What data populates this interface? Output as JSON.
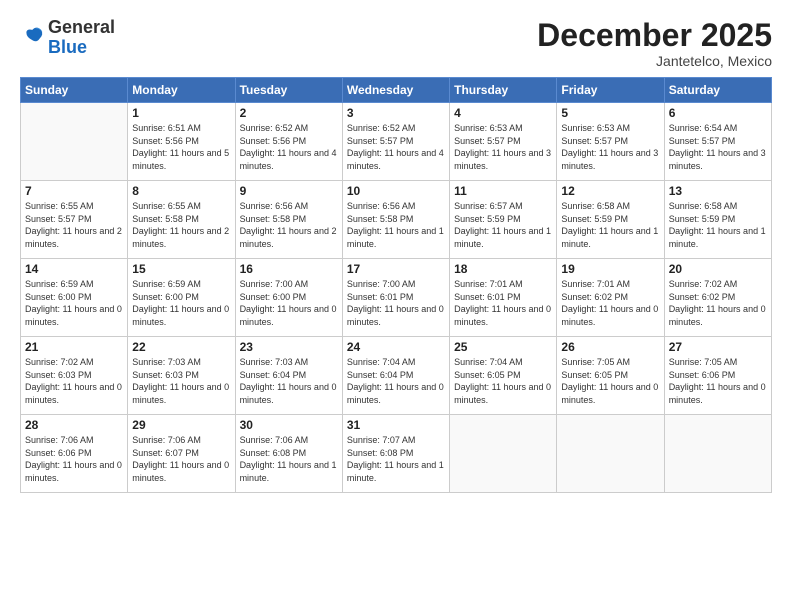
{
  "logo": {
    "general": "General",
    "blue": "Blue"
  },
  "title": "December 2025",
  "subtitle": "Jantetelco, Mexico",
  "days_header": [
    "Sunday",
    "Monday",
    "Tuesday",
    "Wednesday",
    "Thursday",
    "Friday",
    "Saturday"
  ],
  "weeks": [
    [
      {
        "day": "",
        "sunrise": "",
        "sunset": "",
        "daylight": ""
      },
      {
        "day": "1",
        "sunrise": "Sunrise: 6:51 AM",
        "sunset": "Sunset: 5:56 PM",
        "daylight": "Daylight: 11 hours and 5 minutes."
      },
      {
        "day": "2",
        "sunrise": "Sunrise: 6:52 AM",
        "sunset": "Sunset: 5:56 PM",
        "daylight": "Daylight: 11 hours and 4 minutes."
      },
      {
        "day": "3",
        "sunrise": "Sunrise: 6:52 AM",
        "sunset": "Sunset: 5:57 PM",
        "daylight": "Daylight: 11 hours and 4 minutes."
      },
      {
        "day": "4",
        "sunrise": "Sunrise: 6:53 AM",
        "sunset": "Sunset: 5:57 PM",
        "daylight": "Daylight: 11 hours and 3 minutes."
      },
      {
        "day": "5",
        "sunrise": "Sunrise: 6:53 AM",
        "sunset": "Sunset: 5:57 PM",
        "daylight": "Daylight: 11 hours and 3 minutes."
      },
      {
        "day": "6",
        "sunrise": "Sunrise: 6:54 AM",
        "sunset": "Sunset: 5:57 PM",
        "daylight": "Daylight: 11 hours and 3 minutes."
      }
    ],
    [
      {
        "day": "7",
        "sunrise": "Sunrise: 6:55 AM",
        "sunset": "Sunset: 5:57 PM",
        "daylight": "Daylight: 11 hours and 2 minutes."
      },
      {
        "day": "8",
        "sunrise": "Sunrise: 6:55 AM",
        "sunset": "Sunset: 5:58 PM",
        "daylight": "Daylight: 11 hours and 2 minutes."
      },
      {
        "day": "9",
        "sunrise": "Sunrise: 6:56 AM",
        "sunset": "Sunset: 5:58 PM",
        "daylight": "Daylight: 11 hours and 2 minutes."
      },
      {
        "day": "10",
        "sunrise": "Sunrise: 6:56 AM",
        "sunset": "Sunset: 5:58 PM",
        "daylight": "Daylight: 11 hours and 1 minute."
      },
      {
        "day": "11",
        "sunrise": "Sunrise: 6:57 AM",
        "sunset": "Sunset: 5:59 PM",
        "daylight": "Daylight: 11 hours and 1 minute."
      },
      {
        "day": "12",
        "sunrise": "Sunrise: 6:58 AM",
        "sunset": "Sunset: 5:59 PM",
        "daylight": "Daylight: 11 hours and 1 minute."
      },
      {
        "day": "13",
        "sunrise": "Sunrise: 6:58 AM",
        "sunset": "Sunset: 5:59 PM",
        "daylight": "Daylight: 11 hours and 1 minute."
      }
    ],
    [
      {
        "day": "14",
        "sunrise": "Sunrise: 6:59 AM",
        "sunset": "Sunset: 6:00 PM",
        "daylight": "Daylight: 11 hours and 0 minutes."
      },
      {
        "day": "15",
        "sunrise": "Sunrise: 6:59 AM",
        "sunset": "Sunset: 6:00 PM",
        "daylight": "Daylight: 11 hours and 0 minutes."
      },
      {
        "day": "16",
        "sunrise": "Sunrise: 7:00 AM",
        "sunset": "Sunset: 6:00 PM",
        "daylight": "Daylight: 11 hours and 0 minutes."
      },
      {
        "day": "17",
        "sunrise": "Sunrise: 7:00 AM",
        "sunset": "Sunset: 6:01 PM",
        "daylight": "Daylight: 11 hours and 0 minutes."
      },
      {
        "day": "18",
        "sunrise": "Sunrise: 7:01 AM",
        "sunset": "Sunset: 6:01 PM",
        "daylight": "Daylight: 11 hours and 0 minutes."
      },
      {
        "day": "19",
        "sunrise": "Sunrise: 7:01 AM",
        "sunset": "Sunset: 6:02 PM",
        "daylight": "Daylight: 11 hours and 0 minutes."
      },
      {
        "day": "20",
        "sunrise": "Sunrise: 7:02 AM",
        "sunset": "Sunset: 6:02 PM",
        "daylight": "Daylight: 11 hours and 0 minutes."
      }
    ],
    [
      {
        "day": "21",
        "sunrise": "Sunrise: 7:02 AM",
        "sunset": "Sunset: 6:03 PM",
        "daylight": "Daylight: 11 hours and 0 minutes."
      },
      {
        "day": "22",
        "sunrise": "Sunrise: 7:03 AM",
        "sunset": "Sunset: 6:03 PM",
        "daylight": "Daylight: 11 hours and 0 minutes."
      },
      {
        "day": "23",
        "sunrise": "Sunrise: 7:03 AM",
        "sunset": "Sunset: 6:04 PM",
        "daylight": "Daylight: 11 hours and 0 minutes."
      },
      {
        "day": "24",
        "sunrise": "Sunrise: 7:04 AM",
        "sunset": "Sunset: 6:04 PM",
        "daylight": "Daylight: 11 hours and 0 minutes."
      },
      {
        "day": "25",
        "sunrise": "Sunrise: 7:04 AM",
        "sunset": "Sunset: 6:05 PM",
        "daylight": "Daylight: 11 hours and 0 minutes."
      },
      {
        "day": "26",
        "sunrise": "Sunrise: 7:05 AM",
        "sunset": "Sunset: 6:05 PM",
        "daylight": "Daylight: 11 hours and 0 minutes."
      },
      {
        "day": "27",
        "sunrise": "Sunrise: 7:05 AM",
        "sunset": "Sunset: 6:06 PM",
        "daylight": "Daylight: 11 hours and 0 minutes."
      }
    ],
    [
      {
        "day": "28",
        "sunrise": "Sunrise: 7:06 AM",
        "sunset": "Sunset: 6:06 PM",
        "daylight": "Daylight: 11 hours and 0 minutes."
      },
      {
        "day": "29",
        "sunrise": "Sunrise: 7:06 AM",
        "sunset": "Sunset: 6:07 PM",
        "daylight": "Daylight: 11 hours and 0 minutes."
      },
      {
        "day": "30",
        "sunrise": "Sunrise: 7:06 AM",
        "sunset": "Sunset: 6:08 PM",
        "daylight": "Daylight: 11 hours and 1 minute."
      },
      {
        "day": "31",
        "sunrise": "Sunrise: 7:07 AM",
        "sunset": "Sunset: 6:08 PM",
        "daylight": "Daylight: 11 hours and 1 minute."
      },
      {
        "day": "",
        "sunrise": "",
        "sunset": "",
        "daylight": ""
      },
      {
        "day": "",
        "sunrise": "",
        "sunset": "",
        "daylight": ""
      },
      {
        "day": "",
        "sunrise": "",
        "sunset": "",
        "daylight": ""
      }
    ]
  ]
}
